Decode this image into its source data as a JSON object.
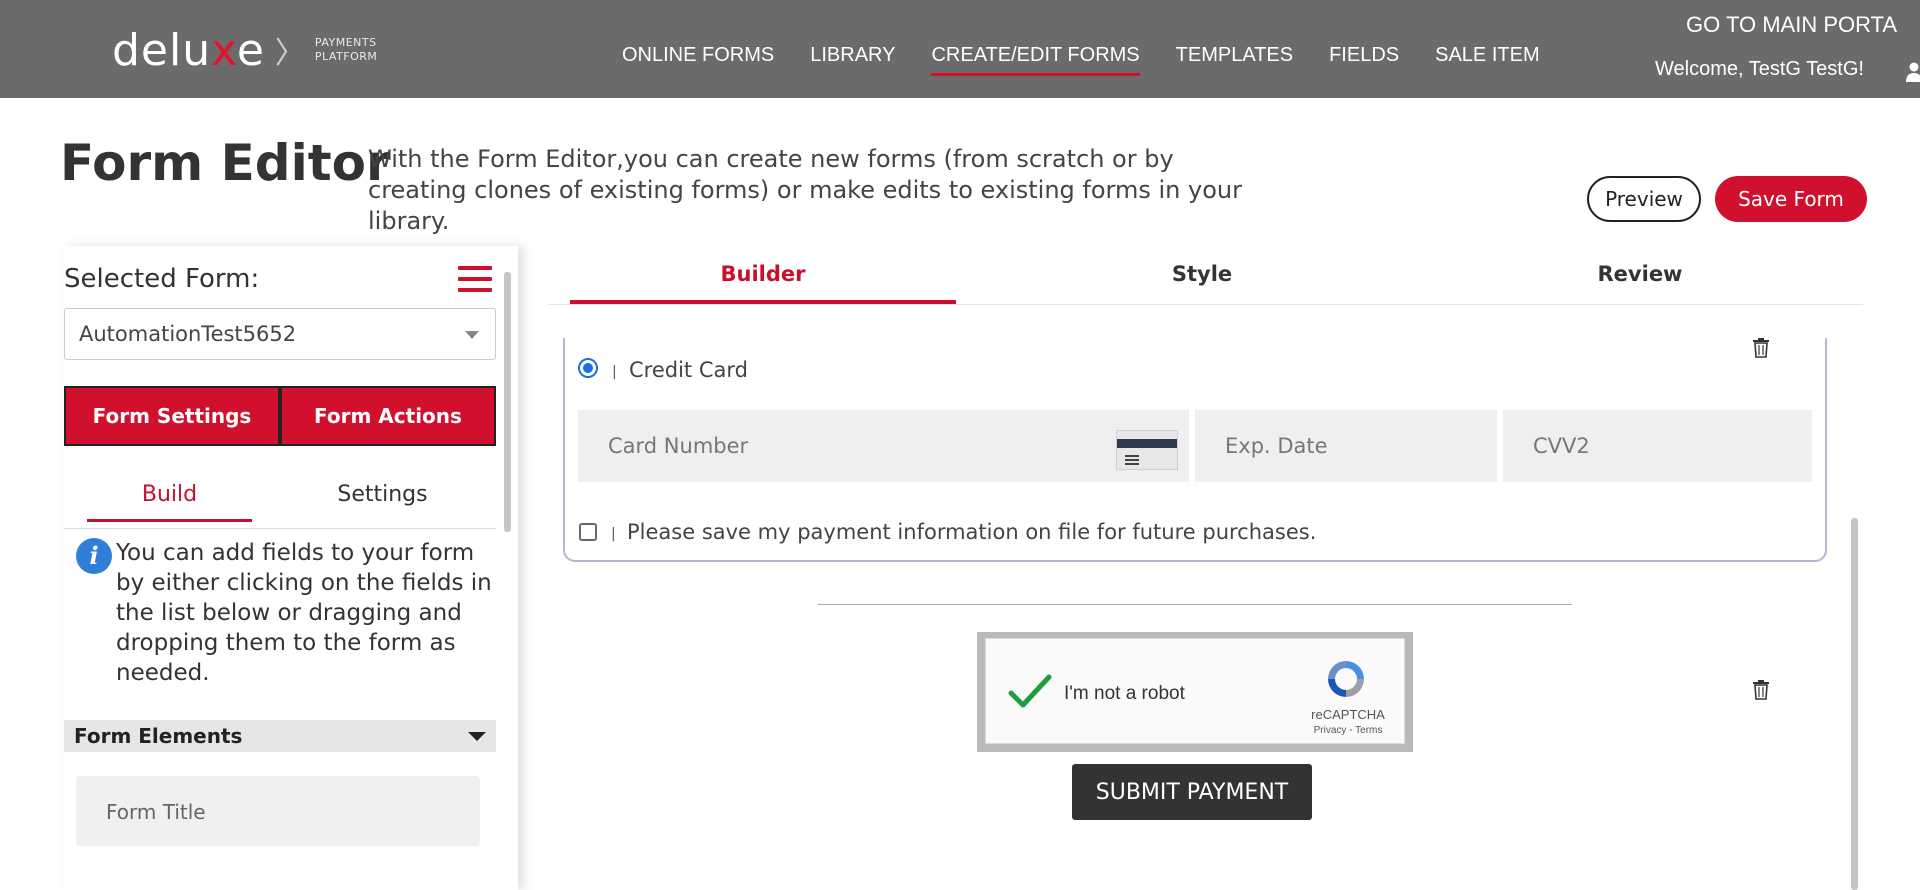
{
  "header": {
    "logo": {
      "word_pre": "delu",
      "word_x": "x",
      "word_post": "e",
      "chevron": "〉",
      "sub_line1": "PAYMENTS",
      "sub_line2": "PLATFORM"
    },
    "nav": [
      {
        "label": "ONLINE FORMS",
        "active": false
      },
      {
        "label": "LIBRARY",
        "active": false
      },
      {
        "label": "CREATE/EDIT FORMS",
        "active": true
      },
      {
        "label": "TEMPLATES",
        "active": false
      },
      {
        "label": "FIELDS",
        "active": false
      },
      {
        "label": "SALE ITEM",
        "active": false
      }
    ],
    "main_portal_link": "GO TO MAIN PORTA",
    "welcome": "Welcome, TestG TestG!",
    "user_icon": "user-icon"
  },
  "page": {
    "title": "Form Editor",
    "description": "With the Form Editor,you can create new forms (from scratch or by creating clones of existing forms) or make edits to existing forms in your library.",
    "preview_label": "Preview",
    "save_label": "Save Form"
  },
  "sidebar": {
    "selected_form_label": "Selected Form:",
    "selected_form_value": "AutomationTest5652",
    "menu_icon": "hamburger-icon",
    "form_settings_label": "Form Settings",
    "form_actions_label": "Form Actions",
    "tabs": [
      {
        "label": "Build",
        "active": true
      },
      {
        "label": "Settings",
        "active": false
      }
    ],
    "info_icon_glyph": "i",
    "info_text": "You can add fields to your form by either clicking on the fields in the list below or dragging and dropping them to the form as needed.",
    "form_elements_label": "Form Elements",
    "elements": [
      "Form Title"
    ]
  },
  "builder": {
    "tabs": [
      {
        "label": "Builder",
        "active": true
      },
      {
        "label": "Style",
        "active": false
      },
      {
        "label": "Review",
        "active": false
      }
    ],
    "payment": {
      "separator": "|",
      "credit_card_label": "Credit Card",
      "credit_card_selected": true,
      "card_number_placeholder": "Card Number",
      "exp_date_placeholder": "Exp. Date",
      "cvv_placeholder": "CVV2",
      "save_info_label": "Please save my payment information on file for future purchases.",
      "save_info_checked": false
    },
    "captcha": {
      "text": "I'm not a robot",
      "brand": "reCAPTCHA",
      "links": "Privacy - Terms"
    },
    "submit_label": "SUBMIT PAYMENT"
  },
  "colors": {
    "header_bg": "#6b6b6b",
    "accent_red": "#d0102d",
    "radio_blue": "#1d6fe6",
    "info_blue": "#2f7fd8"
  }
}
